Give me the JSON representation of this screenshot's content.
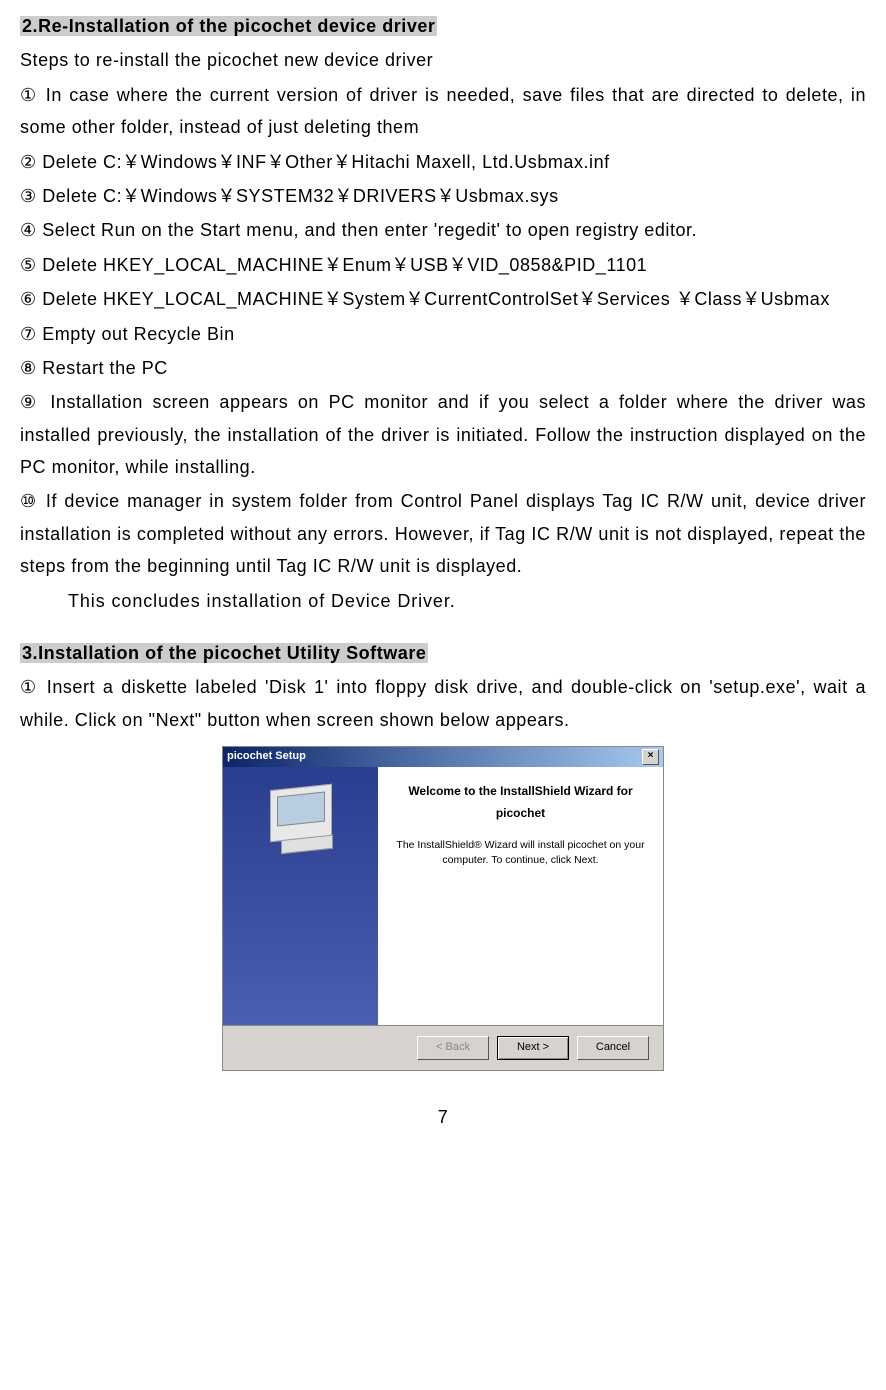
{
  "section2": {
    "title": "2.Re-Installation of the picochet device driver",
    "intro": "Steps to re-install the picochet new device driver",
    "steps": [
      "① In case where the current version of driver is needed, save files that are directed to delete, in some other folder, instead of just deleting them",
      "② Delete C:￥Windows￥INF￥Other￥Hitachi Maxell, Ltd.Usbmax.inf",
      "③ Delete C:￥Windows￥SYSTEM32￥DRIVERS￥Usbmax.sys",
      "④ Select Run on the Start menu, and then enter 'regedit' to open registry editor.",
      "⑤ Delete HKEY_LOCAL_MACHINE￥Enum￥USB￥VID_0858&PID_1101",
      "⑥ Delete HKEY_LOCAL_MACHINE￥System￥CurrentControlSet￥Services ￥Class￥Usbmax",
      "⑦ Empty out Recycle Bin",
      "⑧ Restart the PC",
      "⑨ Installation screen appears on PC monitor and if you select a folder where the driver was installed previously, the installation of the driver is initiated. Follow the instruction displayed on the PC monitor, while installing.",
      "⑩ If device manager in system folder from Control Panel displays Tag IC R/W unit, device driver installation is completed without any errors. However, if Tag IC R/W unit is not displayed, repeat the steps from the beginning until Tag IC R/W unit is displayed."
    ],
    "conclude": "This concludes installation of Device Driver."
  },
  "section3": {
    "title": "3.Installation of the picochet Utility Software",
    "step1": "① Insert a diskette labeled 'Disk 1' into floppy disk drive, and double-click on 'setup.exe', wait a while. Click on \"Next\" button when screen shown below appears."
  },
  "wizard": {
    "titlebar": "picochet Setup",
    "welcome": "Welcome to the InstallShield Wizard for picochet",
    "desc": "The InstallShield® Wizard will install picochet on your computer. To continue, click Next.",
    "back": "< Back",
    "next": "Next >",
    "cancel": "Cancel"
  },
  "page_number": "7"
}
